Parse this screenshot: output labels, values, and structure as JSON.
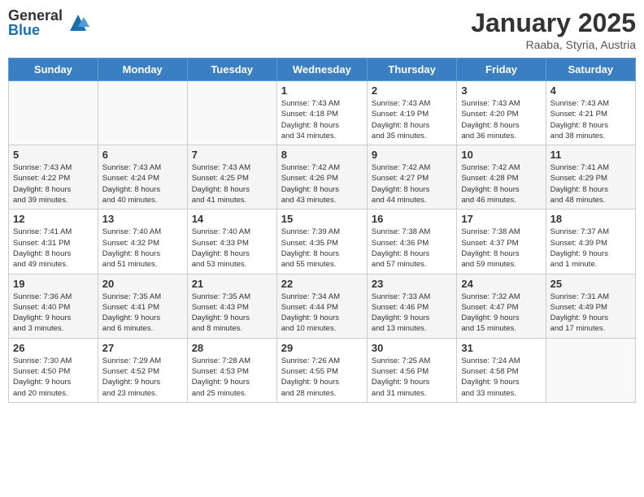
{
  "header": {
    "logo_general": "General",
    "logo_blue": "Blue",
    "month_title": "January 2025",
    "location": "Raaba, Styria, Austria"
  },
  "days_of_week": [
    "Sunday",
    "Monday",
    "Tuesday",
    "Wednesday",
    "Thursday",
    "Friday",
    "Saturday"
  ],
  "weeks": [
    {
      "days": [
        {
          "number": "",
          "info": ""
        },
        {
          "number": "",
          "info": ""
        },
        {
          "number": "",
          "info": ""
        },
        {
          "number": "1",
          "info": "Sunrise: 7:43 AM\nSunset: 4:18 PM\nDaylight: 8 hours\nand 34 minutes."
        },
        {
          "number": "2",
          "info": "Sunrise: 7:43 AM\nSunset: 4:19 PM\nDaylight: 8 hours\nand 35 minutes."
        },
        {
          "number": "3",
          "info": "Sunrise: 7:43 AM\nSunset: 4:20 PM\nDaylight: 8 hours\nand 36 minutes."
        },
        {
          "number": "4",
          "info": "Sunrise: 7:43 AM\nSunset: 4:21 PM\nDaylight: 8 hours\nand 38 minutes."
        }
      ]
    },
    {
      "days": [
        {
          "number": "5",
          "info": "Sunrise: 7:43 AM\nSunset: 4:22 PM\nDaylight: 8 hours\nand 39 minutes."
        },
        {
          "number": "6",
          "info": "Sunrise: 7:43 AM\nSunset: 4:24 PM\nDaylight: 8 hours\nand 40 minutes."
        },
        {
          "number": "7",
          "info": "Sunrise: 7:43 AM\nSunset: 4:25 PM\nDaylight: 8 hours\nand 41 minutes."
        },
        {
          "number": "8",
          "info": "Sunrise: 7:42 AM\nSunset: 4:26 PM\nDaylight: 8 hours\nand 43 minutes."
        },
        {
          "number": "9",
          "info": "Sunrise: 7:42 AM\nSunset: 4:27 PM\nDaylight: 8 hours\nand 44 minutes."
        },
        {
          "number": "10",
          "info": "Sunrise: 7:42 AM\nSunset: 4:28 PM\nDaylight: 8 hours\nand 46 minutes."
        },
        {
          "number": "11",
          "info": "Sunrise: 7:41 AM\nSunset: 4:29 PM\nDaylight: 8 hours\nand 48 minutes."
        }
      ]
    },
    {
      "days": [
        {
          "number": "12",
          "info": "Sunrise: 7:41 AM\nSunset: 4:31 PM\nDaylight: 8 hours\nand 49 minutes."
        },
        {
          "number": "13",
          "info": "Sunrise: 7:40 AM\nSunset: 4:32 PM\nDaylight: 8 hours\nand 51 minutes."
        },
        {
          "number": "14",
          "info": "Sunrise: 7:40 AM\nSunset: 4:33 PM\nDaylight: 8 hours\nand 53 minutes."
        },
        {
          "number": "15",
          "info": "Sunrise: 7:39 AM\nSunset: 4:35 PM\nDaylight: 8 hours\nand 55 minutes."
        },
        {
          "number": "16",
          "info": "Sunrise: 7:38 AM\nSunset: 4:36 PM\nDaylight: 8 hours\nand 57 minutes."
        },
        {
          "number": "17",
          "info": "Sunrise: 7:38 AM\nSunset: 4:37 PM\nDaylight: 8 hours\nand 59 minutes."
        },
        {
          "number": "18",
          "info": "Sunrise: 7:37 AM\nSunset: 4:39 PM\nDaylight: 9 hours\nand 1 minute."
        }
      ]
    },
    {
      "days": [
        {
          "number": "19",
          "info": "Sunrise: 7:36 AM\nSunset: 4:40 PM\nDaylight: 9 hours\nand 3 minutes."
        },
        {
          "number": "20",
          "info": "Sunrise: 7:35 AM\nSunset: 4:41 PM\nDaylight: 9 hours\nand 6 minutes."
        },
        {
          "number": "21",
          "info": "Sunrise: 7:35 AM\nSunset: 4:43 PM\nDaylight: 9 hours\nand 8 minutes."
        },
        {
          "number": "22",
          "info": "Sunrise: 7:34 AM\nSunset: 4:44 PM\nDaylight: 9 hours\nand 10 minutes."
        },
        {
          "number": "23",
          "info": "Sunrise: 7:33 AM\nSunset: 4:46 PM\nDaylight: 9 hours\nand 13 minutes."
        },
        {
          "number": "24",
          "info": "Sunrise: 7:32 AM\nSunset: 4:47 PM\nDaylight: 9 hours\nand 15 minutes."
        },
        {
          "number": "25",
          "info": "Sunrise: 7:31 AM\nSunset: 4:49 PM\nDaylight: 9 hours\nand 17 minutes."
        }
      ]
    },
    {
      "days": [
        {
          "number": "26",
          "info": "Sunrise: 7:30 AM\nSunset: 4:50 PM\nDaylight: 9 hours\nand 20 minutes."
        },
        {
          "number": "27",
          "info": "Sunrise: 7:29 AM\nSunset: 4:52 PM\nDaylight: 9 hours\nand 23 minutes."
        },
        {
          "number": "28",
          "info": "Sunrise: 7:28 AM\nSunset: 4:53 PM\nDaylight: 9 hours\nand 25 minutes."
        },
        {
          "number": "29",
          "info": "Sunrise: 7:26 AM\nSunset: 4:55 PM\nDaylight: 9 hours\nand 28 minutes."
        },
        {
          "number": "30",
          "info": "Sunrise: 7:25 AM\nSunset: 4:56 PM\nDaylight: 9 hours\nand 31 minutes."
        },
        {
          "number": "31",
          "info": "Sunrise: 7:24 AM\nSunset: 4:58 PM\nDaylight: 9 hours\nand 33 minutes."
        },
        {
          "number": "",
          "info": ""
        }
      ]
    }
  ]
}
